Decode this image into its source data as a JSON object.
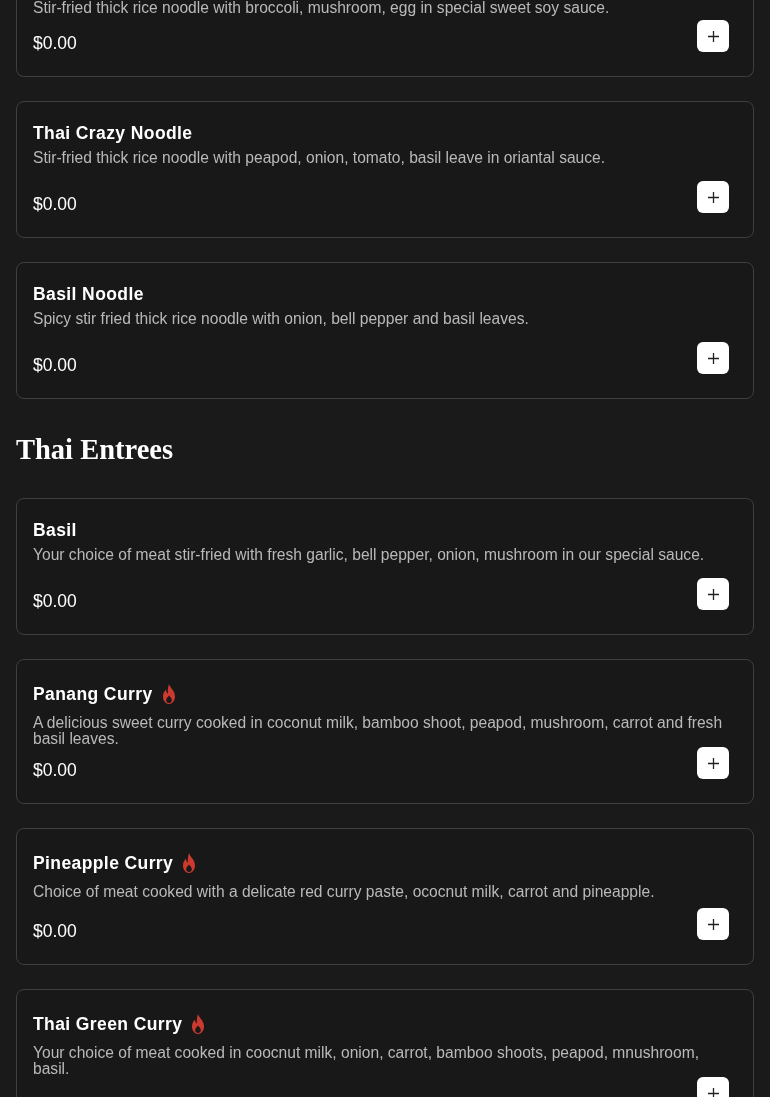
{
  "sections": [
    {
      "items": [
        {
          "description": "Stir-fried thick rice noodle with broccoli, mushroom, egg in special sweet soy sauce.",
          "price": "$0.00",
          "spicy": false
        },
        {
          "name": "Thai Crazy Noodle",
          "description": "Stir-fried thick rice noodle with peapod, onion, tomato, basil leave in oriantal sauce.",
          "price": "$0.00",
          "spicy": false
        },
        {
          "name": "Basil Noodle",
          "description": "Spicy stir fried thick rice noodle with onion, bell pepper and basil leaves.",
          "price": "$0.00",
          "spicy": false
        }
      ]
    },
    {
      "heading": "Thai Entrees",
      "items": [
        {
          "name": "Basil",
          "description": "Your choice of meat stir-fried with fresh garlic, bell pepper, onion, mushroom in our special sauce.",
          "price": "$0.00",
          "spicy": false
        },
        {
          "name": "Panang Curry",
          "description": "A delicious sweet curry cooked in coconut milk, bamboo shoot, peapod, mushroom, carrot and fresh basil leaves.",
          "price": "$0.00",
          "spicy": true
        },
        {
          "name": "Pineapple Curry",
          "description": "Choice of meat cooked with a delicate red curry paste, ococnut milk, carrot and pineapple.",
          "price": "$0.00",
          "spicy": true
        },
        {
          "name": "Thai Green Curry",
          "description": "Your choice of meat cooked in coocnut milk, onion, carrot, bamboo shoots, peapod, mnushroom, basil.",
          "spicy": true
        }
      ]
    }
  ]
}
